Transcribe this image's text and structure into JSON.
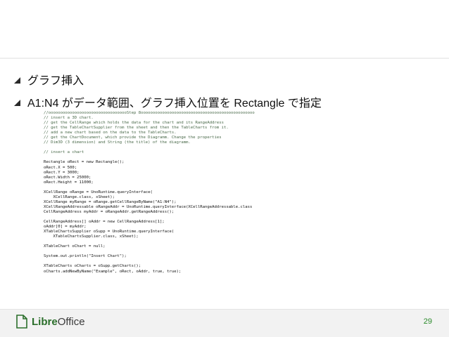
{
  "bullets": [
    {
      "text": "グラフ挿入"
    },
    {
      "text": "A1:N4 がデータ範囲、グラフ挿入位置を  Rectangle  で指定"
    }
  ],
  "code_lines": [
    "//oooooooooooooooooooooooooooooooooStep 8oooooooooooooooooooooooooooooooooooooooooooooooo",
    "// insert a 3D chart.",
    "// get the CellRange which holds the data for the chart and its RangeAddress",
    "// get the TableChartSupplier from the sheet and then the TableCharts from it.",
    "// add a new chart based on the data to the TableCharts.",
    "// get the ChartDocument, which provide the Diagramm. Change the properties",
    "// Dim3D (3 dimension) and String (the title) of the diagramm.",
    "",
    "// insert a chart",
    "",
    "Rectangle oRect = new Rectangle();",
    "oRect.X = 500;",
    "oRect.Y = 3000;",
    "oRect.Width = 25000;",
    "oRect.Height = 11000;",
    "",
    "XCellRange oRange = UnoRuntime.queryInterface(",
    "    XCellRange.class, xSheet);",
    "XCellRange myRange = oRange.getCellRangeByName(\"A1:N4\");",
    "XCellRangeAddressable oRangeAddr = UnoRuntime.queryInterface(XCellRangeAddressable.class",
    "CellRangeAddress myAddr = oRangeAddr.getRangeAddress();",
    "",
    "CellRangeAddress[] oAddr = new CellRangeAddress[1];",
    "oAddr[0] = myAddr;",
    "XTableChartsSupplier oSupp = UnoRuntime.queryInterface(",
    "    XTableChartsSupplier.class, xSheet);",
    "",
    "XTableChart oChart = null;",
    "",
    "System.out.println(\"Insert Chart\");",
    "",
    "XTableCharts oCharts = oSupp.getCharts();",
    "oCharts.addNewByName(\"Example\", oRect, oAddr, true, true);"
  ],
  "footer": {
    "logo_libre": "Libre",
    "logo_office": "Office",
    "page_number": "29"
  },
  "colors": {
    "accent_green": "#2a8a2a",
    "footer_bg": "#f2f2f2"
  }
}
